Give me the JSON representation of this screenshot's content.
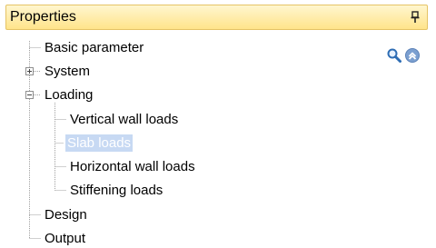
{
  "panel": {
    "title": "Properties",
    "icons": {
      "pin": "pin-icon",
      "search": "search-icon",
      "collapse_up": "chevron-up-circle-icon"
    }
  },
  "tree": {
    "items": [
      {
        "label": "Basic parameter"
      },
      {
        "label": "System",
        "expander": "collapsed"
      },
      {
        "label": "Loading",
        "expander": "expanded"
      },
      {
        "label": "Vertical wall loads"
      },
      {
        "label": "Slab loads",
        "selected": true
      },
      {
        "label": "Horizontal wall loads"
      },
      {
        "label": "Stiffening loads"
      },
      {
        "label": "Design"
      },
      {
        "label": "Output"
      }
    ]
  },
  "colors": {
    "header_top": "#fff6cf",
    "header_bottom": "#ffe48a",
    "header_border": "#e5c365",
    "selection": "#c7d9f3",
    "connector": "#a0a0a0"
  }
}
